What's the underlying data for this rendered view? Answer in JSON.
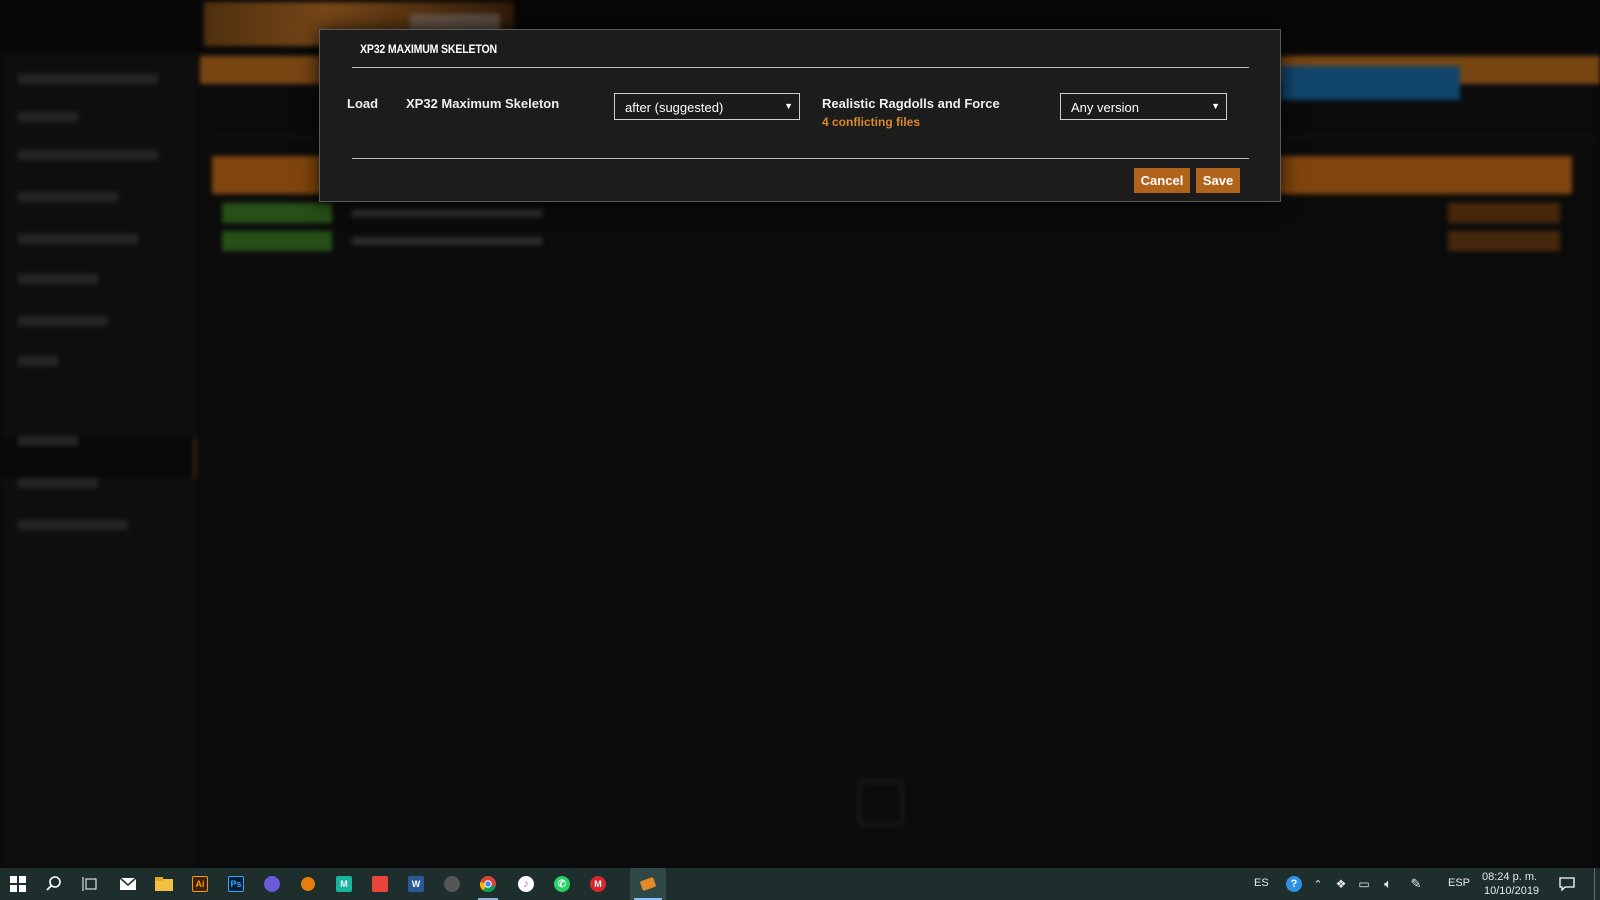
{
  "dialog": {
    "title": "XP32 MAXIMUM SKELETON",
    "load_label": "Load",
    "mod_name": "XP32 Maximum Skeleton",
    "order_select": {
      "value": "after (suggested)"
    },
    "other_mod_name": "Realistic Ragdolls and Force",
    "conflict_text": "4 conflicting files",
    "version_select": {
      "value": "Any version"
    },
    "cancel_label": "Cancel",
    "save_label": "Save"
  },
  "taskbar": {
    "icons": [
      "windows-start-icon",
      "search-icon",
      "task-view-icon",
      "mail-icon",
      "file-explorer-icon",
      "illustrator-icon",
      "photoshop-icon",
      "app-icon",
      "blender-icon",
      "app-m-icon",
      "app-icon",
      "app-icon",
      "app-icon",
      "chrome-icon",
      "itunes-icon",
      "whatsapp-icon",
      "mega-icon",
      "vortex-icon"
    ],
    "lang_short": "ES",
    "lang_long": "ESP",
    "time": "08:24 p. m.",
    "date": "10/10/2019"
  },
  "colors": {
    "accent": "#b1621b",
    "conflict": "#d98a2a",
    "taskbar": "#1d2e2c"
  }
}
